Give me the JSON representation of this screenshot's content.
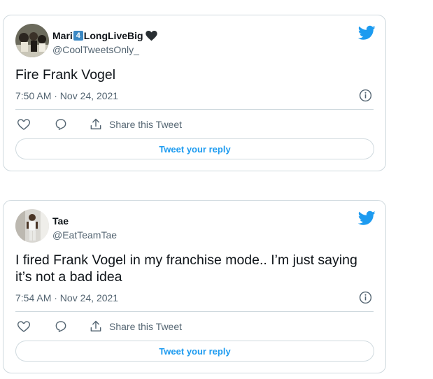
{
  "colors": {
    "accent": "#1d9bf0",
    "text": "#0f1419",
    "secondary_text": "#536471",
    "border": "#cfd9de"
  },
  "tweets": [
    {
      "display_name_part1": "Mari",
      "display_name_emoji": "4",
      "display_name_part2": "LongLiveBig",
      "display_name_trailing_emoji": "black-heart-icon",
      "handle": "@CoolTweetsOnly_",
      "text": "Fire Frank Vogel",
      "timestamp": "7:50 AM · Nov 24, 2021",
      "share_label": "Share this Tweet",
      "reply_label": "Tweet your reply"
    },
    {
      "display_name": "Tae",
      "handle": "@EatTeamTae",
      "text": "I fired Frank Vogel in my franchise mode.. I’m just saying it’s not a bad idea",
      "timestamp": "7:54 AM · Nov 24, 2021",
      "share_label": "Share this Tweet",
      "reply_label": "Tweet your reply"
    }
  ],
  "icons": {
    "logo": "twitter-bird-icon",
    "info": "info-icon",
    "like": "heart-icon",
    "reply": "reply-icon",
    "share": "share-icon"
  }
}
